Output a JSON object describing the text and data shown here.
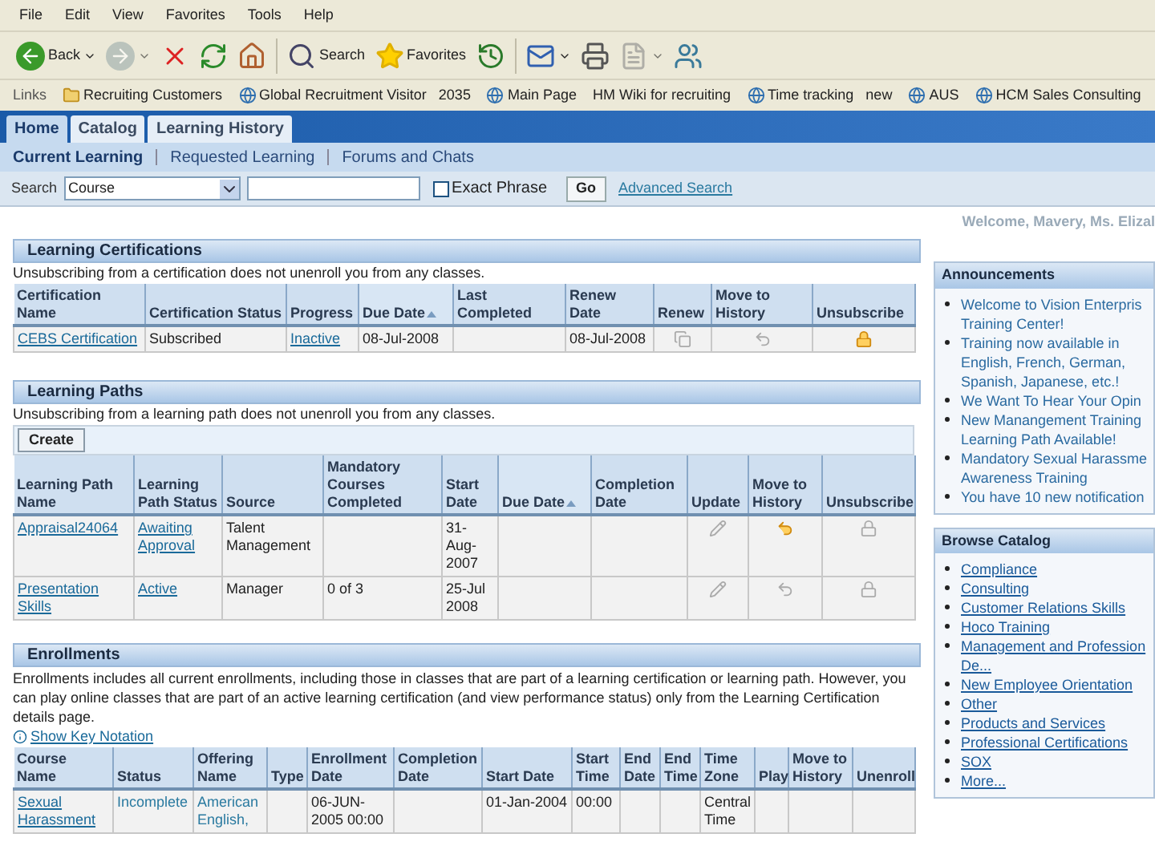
{
  "menu": [
    "File",
    "Edit",
    "View",
    "Favorites",
    "Tools",
    "Help"
  ],
  "toolbar": [
    {
      "kind": "back",
      "label": "Back",
      "has_menu": true,
      "disabled": false
    },
    {
      "kind": "forward",
      "has_menu": true,
      "disabled": true
    },
    {
      "kind": "stop",
      "disabled": false
    },
    {
      "kind": "refresh",
      "disabled": false
    },
    {
      "kind": "home",
      "disabled": false,
      "separator_after": true
    },
    {
      "kind": "search",
      "label": "Search",
      "disabled": false
    },
    {
      "kind": "favorites",
      "label": "Favorites",
      "disabled": false
    },
    {
      "kind": "history",
      "disabled": false,
      "separator_after": true
    },
    {
      "kind": "mail",
      "has_menu": true,
      "disabled": false
    },
    {
      "kind": "print",
      "disabled": false
    },
    {
      "kind": "edit",
      "has_menu": true,
      "disabled": true
    },
    {
      "kind": "messenger",
      "disabled": false
    }
  ],
  "links": {
    "label": "Links",
    "items": [
      {
        "kind": "folder",
        "label": "Recruiting Customers"
      },
      {
        "kind": "page",
        "label": "Global Recruitment Visitor   2035"
      },
      {
        "kind": "page",
        "label": "Main Page"
      },
      {
        "kind": "plain",
        "label": "HM Wiki for recruiting"
      },
      {
        "kind": "page",
        "label": "Time tracking   new"
      },
      {
        "kind": "page",
        "label": "AUS"
      },
      {
        "kind": "page",
        "label": "HCM Sales Consulting"
      }
    ]
  },
  "tabs": [
    {
      "label": "Home",
      "selected": true
    },
    {
      "label": "Catalog",
      "selected": false
    },
    {
      "label": "Learning History",
      "selected": false
    }
  ],
  "subnav": [
    {
      "label": "Current Learning",
      "selected": true
    },
    {
      "label": "Requested Learning",
      "selected": false
    },
    {
      "label": "Forums and Chats",
      "selected": false
    }
  ],
  "search": {
    "label": "Search",
    "scope": "Course",
    "exact_phrase": {
      "label": "Exact Phrase",
      "checked": false
    },
    "go": "Go",
    "advanced": "Advanced Search"
  },
  "welcome": "Welcome, Mavery, Ms. Elizal",
  "certifications": {
    "title": "Learning Certifications",
    "note": "Unsubscribing from a certification does not unenroll you from any classes.",
    "columns": [
      {
        "label": "Certification Name",
        "sorted": false
      },
      {
        "label": "Certification Status",
        "sorted": false
      },
      {
        "label": "Progress",
        "sorted": false
      },
      {
        "label": "Due Date",
        "sorted": true
      },
      {
        "label": "Last Completed",
        "sorted": false
      },
      {
        "label": "Renew Date",
        "sorted": false
      },
      {
        "label": "Renew",
        "sorted": false
      },
      {
        "label": "Move to History",
        "sorted": false
      },
      {
        "label": "Unsubscribe",
        "sorted": false
      }
    ],
    "rows": [
      {
        "cells": [
          {
            "kind": "link",
            "text": "CEBS Certification"
          },
          {
            "kind": "text",
            "text": "Subscribed"
          },
          {
            "kind": "link",
            "text": "Inactive"
          },
          {
            "kind": "text",
            "text": "08-Jul-2008"
          },
          {
            "kind": "blank"
          },
          {
            "kind": "text",
            "text": "08-Jul-2008"
          },
          {
            "kind": "renew",
            "disabled": true
          },
          {
            "kind": "history",
            "disabled": true
          },
          {
            "kind": "unsubscribe",
            "disabled": false
          }
        ]
      }
    ]
  },
  "learning_paths": {
    "title": "Learning Paths",
    "note": "Unsubscribing from a learning path does not unenroll you from any classes.",
    "create": "Create",
    "columns": [
      {
        "label": "Learning Path Name",
        "sorted": false
      },
      {
        "label": "Learning Path Status",
        "sorted": false
      },
      {
        "label": "Source",
        "sorted": false
      },
      {
        "label": "Mandatory Courses Completed",
        "sorted": false
      },
      {
        "label": "Start Date",
        "sorted": false
      },
      {
        "label": "Due Date",
        "sorted": true
      },
      {
        "label": "Completion Date",
        "sorted": false
      },
      {
        "label": "Update",
        "sorted": false
      },
      {
        "label": "Move to History",
        "sorted": false
      },
      {
        "label": "Unsubscribe",
        "sorted": false
      }
    ],
    "rows": [
      {
        "cells": [
          {
            "kind": "link",
            "text": "Appraisal24064"
          },
          {
            "kind": "link",
            "text": "Awaiting Approval"
          },
          {
            "kind": "text",
            "text": "Talent Management"
          },
          {
            "kind": "blank"
          },
          {
            "kind": "text",
            "text": "31-Aug-2007"
          },
          {
            "kind": "blank"
          },
          {
            "kind": "blank"
          },
          {
            "kind": "update",
            "disabled": true
          },
          {
            "kind": "history",
            "disabled": false
          },
          {
            "kind": "unsubscribe",
            "disabled": true
          }
        ]
      },
      {
        "cells": [
          {
            "kind": "link",
            "text": "Presentation Skills"
          },
          {
            "kind": "link",
            "text": "Active"
          },
          {
            "kind": "text",
            "text": "Manager"
          },
          {
            "kind": "text",
            "text": "0 of 3"
          },
          {
            "kind": "text",
            "text": "25-Jul 2008"
          },
          {
            "kind": "blank"
          },
          {
            "kind": "blank"
          },
          {
            "kind": "update",
            "disabled": true
          },
          {
            "kind": "history",
            "disabled": true
          },
          {
            "kind": "unsubscribe",
            "disabled": true
          }
        ]
      }
    ]
  },
  "enrollments": {
    "title": "Enrollments",
    "note": "Enrollments includes all current enrollments, including those in classes that are part of a learning certification or learning path. However, you can play online classes that are part of an active learning certification (and view performance status) only from the Learning Certification details page.",
    "key_notation": "Show Key Notation",
    "columns": [
      {
        "label": "Course Name",
        "sorted": false
      },
      {
        "label": "Status",
        "sorted": false
      },
      {
        "label": "Offering Name",
        "sorted": false
      },
      {
        "label": "Type",
        "sorted": false
      },
      {
        "label": "Enrollment Date",
        "sorted": false
      },
      {
        "label": "Completion Date",
        "sorted": false
      },
      {
        "label": "Start Date",
        "sorted": false
      },
      {
        "label": "Start Time",
        "sorted": false
      },
      {
        "label": "End Date",
        "sorted": false
      },
      {
        "label": "End Time",
        "sorted": false
      },
      {
        "label": "Time Zone",
        "sorted": false
      },
      {
        "label": "Play",
        "sorted": false
      },
      {
        "label": "Move to History",
        "sorted": false
      },
      {
        "label": "Unenroll",
        "sorted": false
      }
    ],
    "rows": [
      {
        "cells": [
          {
            "kind": "link",
            "text": "Sexual Harassment"
          },
          {
            "kind": "status",
            "text": "Incomplete"
          },
          {
            "kind": "status",
            "text": "American English,"
          },
          {
            "kind": "blank"
          },
          {
            "kind": "text",
            "text": "06-JUN-2005 00:00"
          },
          {
            "kind": "blank"
          },
          {
            "kind": "text",
            "text": "01-Jan-2004"
          },
          {
            "kind": "text",
            "text": "00:00"
          },
          {
            "kind": "blank"
          },
          {
            "kind": "blank"
          },
          {
            "kind": "text",
            "text": "Central Time"
          },
          {
            "kind": "blank"
          },
          {
            "kind": "blank"
          },
          {
            "kind": "blank"
          }
        ]
      }
    ]
  },
  "announcements": {
    "title": "Announcements",
    "items": [
      [
        "Welcome to Vision Enterpris",
        "Training Center!"
      ],
      [
        "Training now available in",
        "English, French, German,",
        "Spanish, Japanese, etc.!"
      ],
      [
        "We Want To Hear Your Opin"
      ],
      [
        "New Manangement Training",
        "Learning Path Available!"
      ],
      [
        "Mandatory Sexual Harassme",
        "Awareness Training"
      ],
      [
        "You have 10 new notification"
      ]
    ]
  },
  "browse": {
    "title": "Browse Catalog",
    "items": [
      [
        "Compliance"
      ],
      [
        "Consulting"
      ],
      [
        "Customer Relations Skills"
      ],
      [
        "Hoco Training"
      ],
      [
        "Management and Profession",
        "De..."
      ],
      [
        "New Employee Orientation"
      ],
      [
        "Other"
      ],
      [
        "Products and Services"
      ],
      [
        "Professional Certifications"
      ],
      [
        "SOX"
      ],
      [
        "More..."
      ]
    ]
  }
}
